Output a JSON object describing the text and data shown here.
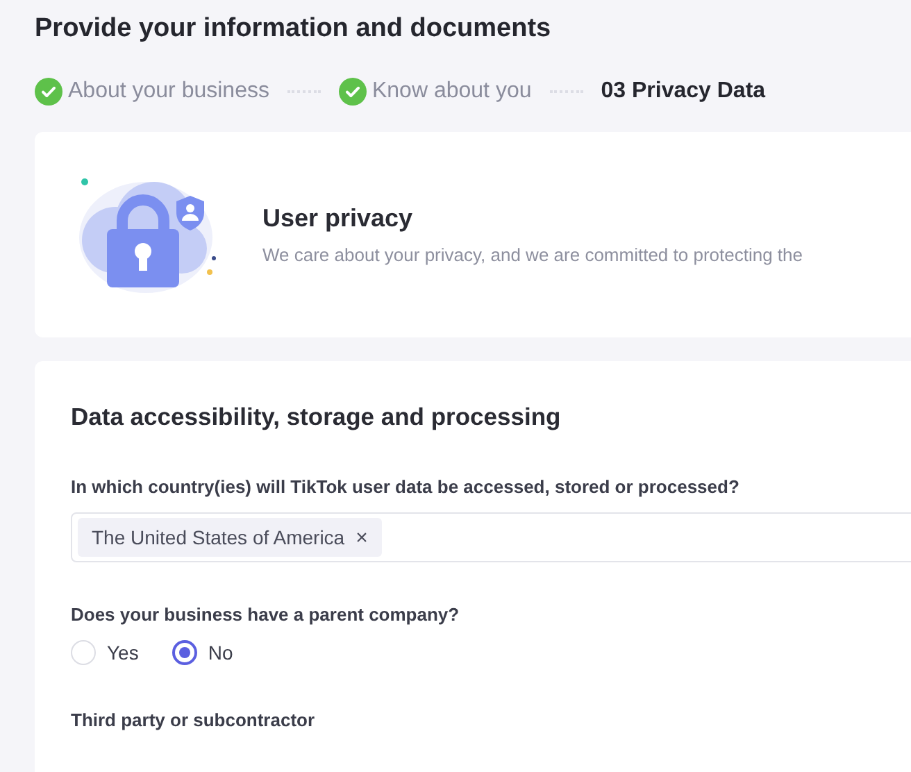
{
  "page": {
    "title": "Provide your information and documents"
  },
  "steps": [
    {
      "label": "About your business",
      "completed": true,
      "selected": false
    },
    {
      "label": "Know about you",
      "completed": true,
      "selected": false
    },
    {
      "label": "03 Privacy Data",
      "completed": false,
      "selected": true
    }
  ],
  "intro_card": {
    "title": "User privacy",
    "description": "We care about your privacy, and we are committed to protecting the"
  },
  "form": {
    "section_title": "Data accessibility, storage and processing",
    "countries": {
      "label": "In which country(ies) will TikTok user data be accessed, stored or processed?",
      "tags": [
        {
          "text": "The United States of America",
          "remove": "×"
        }
      ]
    },
    "parent_company": {
      "label": "Does your business have a parent company?",
      "options": [
        {
          "label": "Yes",
          "selected": false
        },
        {
          "label": "No",
          "selected": true
        }
      ]
    },
    "third_party": {
      "label": "Third party or subcontractor"
    }
  }
}
